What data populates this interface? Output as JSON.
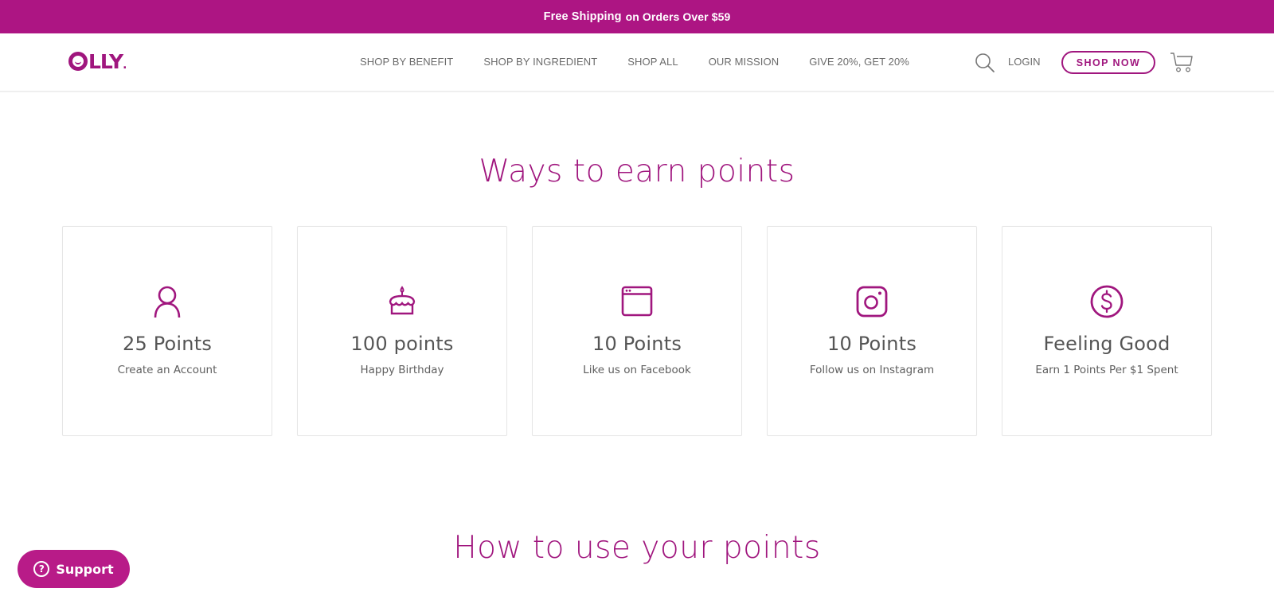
{
  "colors": {
    "brand": "#ad1583",
    "accent": "#a0167e",
    "support": "#b81b88",
    "text": "#555555"
  },
  "promo": {
    "strong": "Free Shipping",
    "rest": "on Orders Over $59"
  },
  "header": {
    "logo": {
      "text_o": "",
      "text_rest": "LLY",
      "dot": "."
    },
    "nav": [
      {
        "label": "SHOP BY BENEFIT"
      },
      {
        "label": "SHOP BY INGREDIENT"
      },
      {
        "label": "SHOP ALL"
      },
      {
        "label": "OUR MISSION"
      },
      {
        "label": "GIVE 20%, GET 20%"
      }
    ],
    "search_icon": "search-icon",
    "login_label": "LOGIN",
    "shop_now_label": "SHOP NOW",
    "cart_icon": "cart-icon"
  },
  "earn": {
    "title": "Ways to earn points",
    "cards": [
      {
        "icon": "user-icon",
        "title": "25 Points",
        "desc": "Create an Account"
      },
      {
        "icon": "birthday-cake-icon",
        "title": "100 points",
        "desc": "Happy Birthday"
      },
      {
        "icon": "browser-window-icon",
        "title": "10 Points",
        "desc": "Like us on Facebook"
      },
      {
        "icon": "instagram-icon",
        "title": "10 Points",
        "desc": "Follow us on Instagram"
      },
      {
        "icon": "dollar-circle-icon",
        "title": "Feeling Good",
        "desc": "Earn 1 Points Per $1 Spent"
      }
    ]
  },
  "use": {
    "title": "How to use your points"
  },
  "support": {
    "icon": "question-circle-icon",
    "label": "Support",
    "q": "?"
  }
}
